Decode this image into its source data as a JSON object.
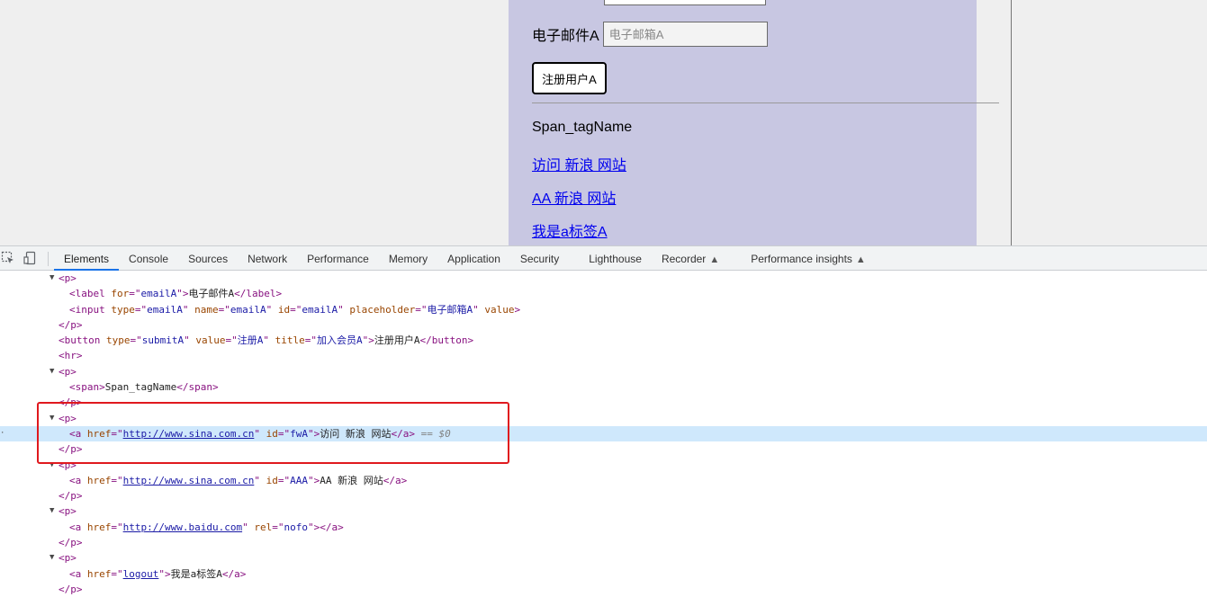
{
  "page": {
    "email_label": "电子邮件A",
    "email_placeholder": "电子邮箱A",
    "email_value": "",
    "register_button": "注册用户A",
    "span_text": "Span_tagName",
    "links": [
      "访问 新浪 网站",
      "AA 新浪 网站",
      "我是a标签A"
    ],
    "panel_color": "#c8c7e2"
  },
  "devtools": {
    "toolbar_icons": [
      "inspect-element-icon",
      "device-toolbar-icon"
    ],
    "tabs": [
      "Elements",
      "Console",
      "Sources",
      "Network",
      "Performance",
      "Memory",
      "Application",
      "Security",
      "Lighthouse",
      "Recorder",
      "Performance insights"
    ],
    "active_tab": "Elements",
    "experimental_tabs": [
      "Recorder",
      "Performance insights"
    ],
    "experimental_icon": "flask-icon",
    "selected_marker": "== $0",
    "highlight_color": "#e0191e",
    "dom": {
      "p": "p",
      "label_tag": "label",
      "for_attr": "for",
      "email_id": "emailA",
      "email_text": "电子邮件A",
      "input_tag": "input",
      "type_attr": "type",
      "name_attr": "name",
      "id_attr": "id",
      "placeholder_attr": "placeholder",
      "value_attr": "value",
      "placeholder_val": "电子邮箱A",
      "button_tag": "button",
      "submit_type": "submitA",
      "value_val": "注册A",
      "title_attr": "title",
      "title_val": "加入会员A",
      "button_text": "注册用户A",
      "hr_tag": "hr",
      "span_tag": "span",
      "span_text": "Span_tagName",
      "a_tag": "a",
      "href_attr": "href",
      "sina_url": "http://www.sina.com.cn",
      "fwA": "fwA",
      "link1_text": "访问 新浪 网站",
      "AAA": "AAA",
      "link2_text": "AA 新浪 网站",
      "baidu_url": "http://www.baidu.com",
      "rel_attr": "rel",
      "rel_val": "nofo",
      "logout": "logout",
      "link3_text": "我是a标签A"
    }
  }
}
